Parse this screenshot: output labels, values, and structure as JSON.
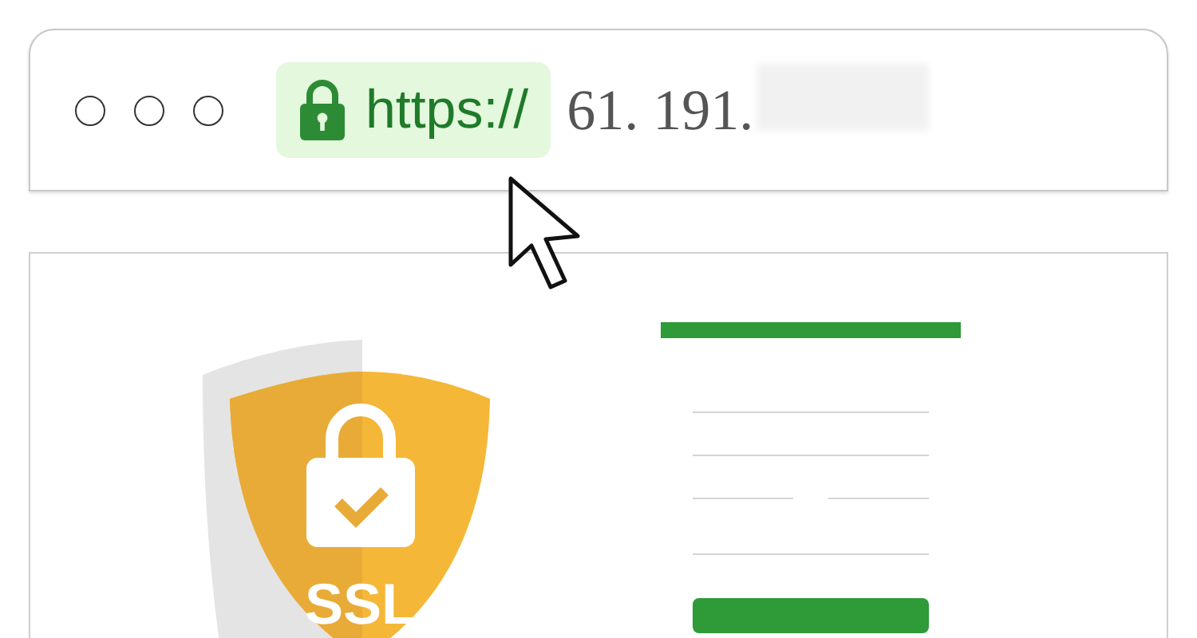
{
  "address_bar": {
    "scheme": "https://",
    "host": "61. 191."
  },
  "shield": {
    "label": "SSL"
  }
}
